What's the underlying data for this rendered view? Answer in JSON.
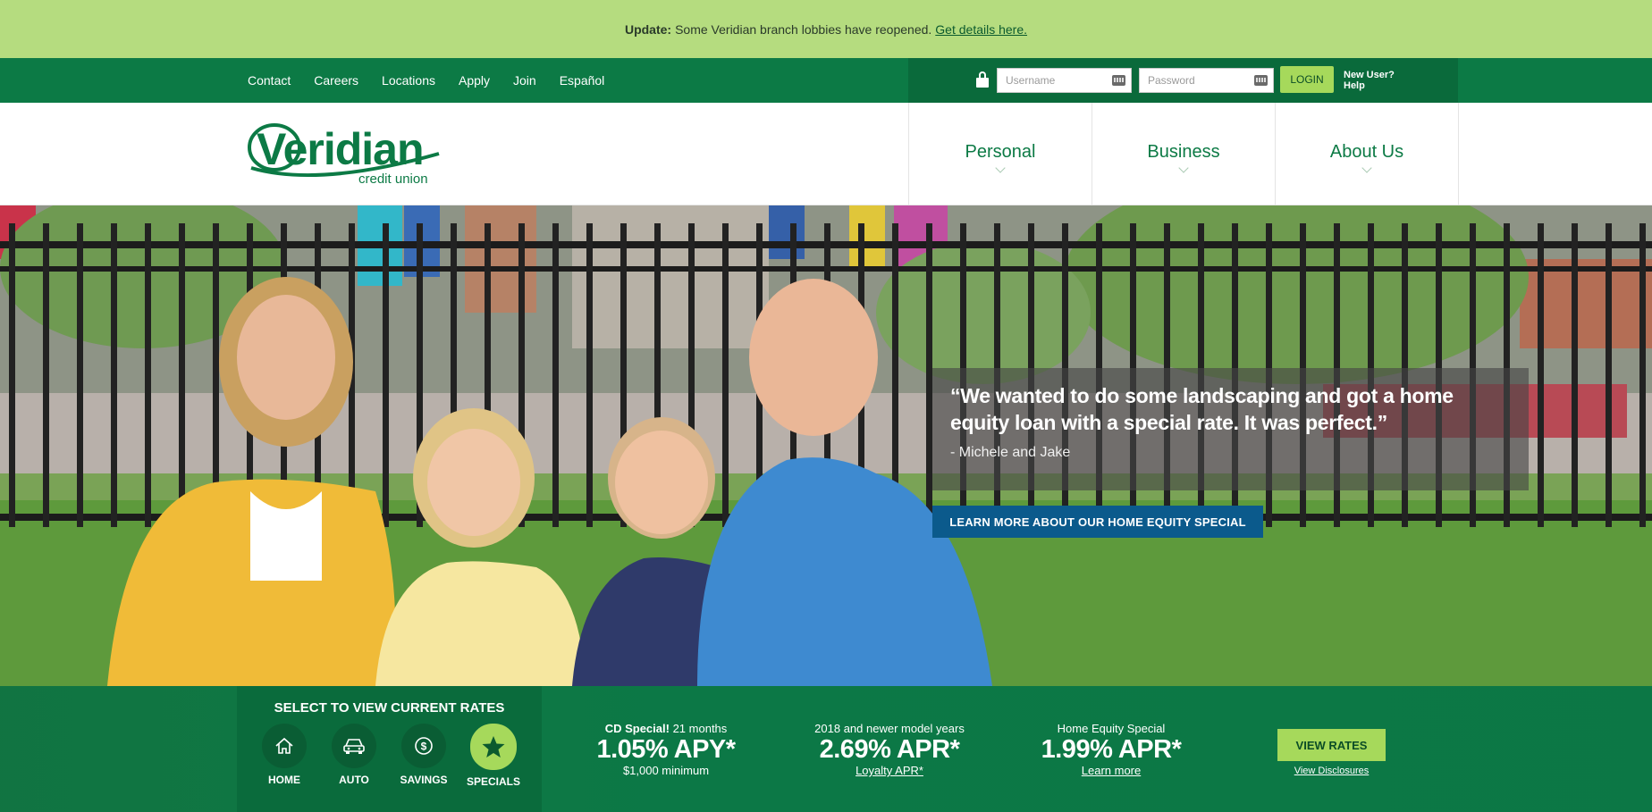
{
  "announcement": {
    "label": "Update:",
    "text": "Some Veridian branch lobbies have reopened.",
    "link": "Get details here."
  },
  "utility_nav": {
    "links": [
      "Contact",
      "Careers",
      "Locations",
      "Apply",
      "Join",
      "Español"
    ]
  },
  "login": {
    "username_placeholder": "Username",
    "password_placeholder": "Password",
    "button": "LOGIN",
    "new_user": "New User?",
    "help": "Help"
  },
  "brand": {
    "name": "Veridian",
    "tagline": "credit union",
    "color": "#0c7a45"
  },
  "main_nav": {
    "items": [
      "Personal",
      "Business",
      "About Us"
    ]
  },
  "hero": {
    "quote": "“We wanted to do some landscaping and got a home equity loan with a special rate. It was perfect.”",
    "attribution": "- Michele and Jake",
    "cta": "LEARN MORE ABOUT OUR HOME EQUITY SPECIAL"
  },
  "rates": {
    "selector_title": "SELECT TO VIEW CURRENT RATES",
    "categories": [
      {
        "label": "HOME",
        "icon": "home-icon"
      },
      {
        "label": "AUTO",
        "icon": "car-icon"
      },
      {
        "label": "SAVINGS",
        "icon": "dollar-icon"
      },
      {
        "label": "SPECIALS",
        "icon": "star-icon",
        "active": true
      }
    ],
    "offers": [
      {
        "top_bold": "CD Special!",
        "top": "21 months",
        "big": "1.05% APY*",
        "sub": "$1,000 minimum",
        "sub_is_link": false
      },
      {
        "top_bold": "",
        "top": "2018 and newer model years",
        "big": "2.69% APR*",
        "sub": "Loyalty APR*",
        "sub_is_link": true
      },
      {
        "top_bold": "",
        "top": "Home Equity Special",
        "big": "1.99% APR*",
        "sub": "Learn more",
        "sub_is_link": true
      }
    ],
    "view_rates": "VIEW RATES",
    "view_disclosures": "View Disclosures",
    "accent": "#a6d95b"
  }
}
